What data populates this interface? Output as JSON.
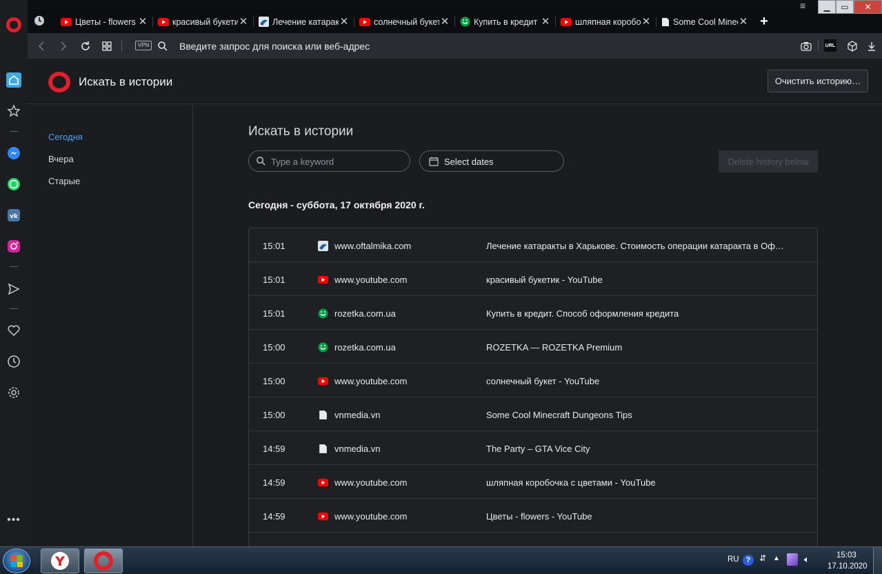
{
  "tabs": [
    {
      "title": "Цветы - flowers",
      "favicon": "youtube-favicon"
    },
    {
      "title": "красивый букетик",
      "favicon": "youtube-favicon"
    },
    {
      "title": "Лечение катаракты",
      "favicon": "oftalmika-favicon"
    },
    {
      "title": "солнечный букет",
      "favicon": "youtube-favicon"
    },
    {
      "title": "Купить в кредит",
      "favicon": "rozetka-favicon"
    },
    {
      "title": "шляпная коробочка",
      "favicon": "youtube-favicon"
    },
    {
      "title": "Some Cool Minecraft",
      "favicon": "page-favicon"
    }
  ],
  "address_bar": {
    "vpn_label": "VPN",
    "placeholder": "Введите запрос для поиска или веб-адрес",
    "url_icon_label": "URL"
  },
  "header": {
    "title": "Искать в истории",
    "clear_button": "Очистить историю…"
  },
  "left_nav": {
    "items": [
      {
        "label": "Сегодня",
        "active": true
      },
      {
        "label": "Вчера",
        "active": false
      },
      {
        "label": "Старые",
        "active": false
      }
    ]
  },
  "main": {
    "title": "Искать в истории",
    "search_placeholder": "Type a keyword",
    "dates_label": "Select dates",
    "delete_button": "Delete history below",
    "day_heading": "Сегодня - суббота, 17 октября 2020 г."
  },
  "history": [
    {
      "time": "15:01",
      "favicon": "oftalmika-favicon",
      "domain": "www.oftalmika.com",
      "title": "Лечение катаракты в Харькове. Стоимость операции катаракта в Оф…"
    },
    {
      "time": "15:01",
      "favicon": "youtube-favicon",
      "domain": "www.youtube.com",
      "title": "красивый букетик - YouTube"
    },
    {
      "time": "15:01",
      "favicon": "rozetka-favicon",
      "domain": "rozetka.com.ua",
      "title": "Купить в кредит. Способ оформления кредита"
    },
    {
      "time": "15:00",
      "favicon": "rozetka-favicon",
      "domain": "rozetka.com.ua",
      "title": "ROZETKA — ROZETKA Premium"
    },
    {
      "time": "15:00",
      "favicon": "youtube-favicon",
      "domain": "www.youtube.com",
      "title": "солнечный букет - YouTube"
    },
    {
      "time": "15:00",
      "favicon": "page-favicon",
      "domain": "vnmedia.vn",
      "title": "Some Cool Minecraft Dungeons Tips"
    },
    {
      "time": "14:59",
      "favicon": "page-favicon",
      "domain": "vnmedia.vn",
      "title": "The Party – GTA Vice City"
    },
    {
      "time": "14:59",
      "favicon": "youtube-favicon",
      "domain": "www.youtube.com",
      "title": "шляпная коробочка с цветами - YouTube"
    },
    {
      "time": "14:59",
      "favicon": "youtube-favicon",
      "domain": "www.youtube.com",
      "title": "Цветы - flowers - YouTube"
    }
  ],
  "taskbar": {
    "language": "RU",
    "clock_time": "15:03",
    "clock_date": "17.10.2020"
  },
  "colors": {
    "accent_blue": "#4aa3f0",
    "opera_red": "#e0202a",
    "youtube_red": "#ff0000",
    "rozetka_green": "#00a046"
  }
}
